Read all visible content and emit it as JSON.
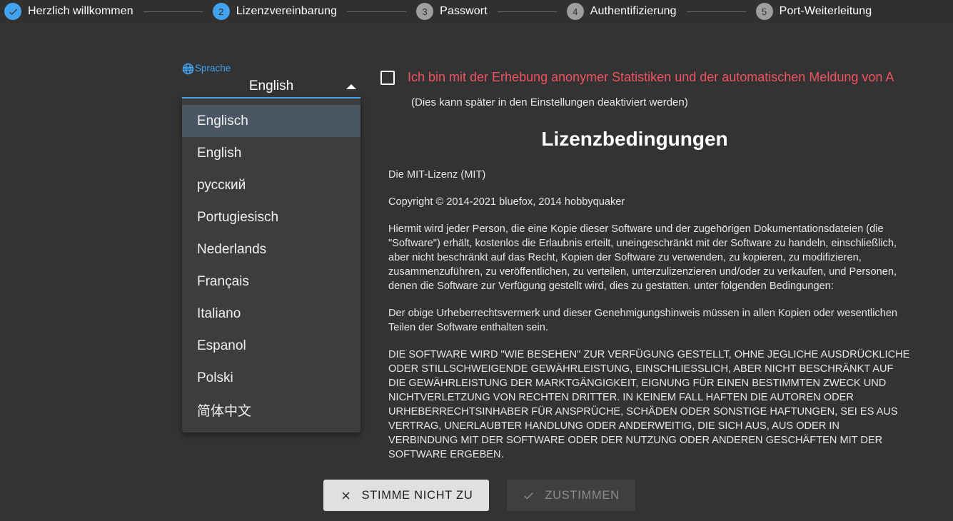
{
  "stepper": {
    "steps": [
      {
        "num": "1",
        "label": "Herzlich willkommen",
        "state": "done"
      },
      {
        "num": "2",
        "label": "Lizenzvereinbarung",
        "state": "active"
      },
      {
        "num": "3",
        "label": "Passwort",
        "state": "todo"
      },
      {
        "num": "4",
        "label": "Authentifizierung",
        "state": "todo"
      },
      {
        "num": "5",
        "label": "Port-Weiterleitung",
        "state": "todo"
      }
    ]
  },
  "language": {
    "caption": "Sprache",
    "selected": "English",
    "options": [
      "Englisch",
      "English",
      "русский",
      "Portugiesisch",
      "Nederlands",
      "Français",
      "Italiano",
      "Espanol",
      "Polski",
      "简体中文"
    ]
  },
  "statistics": {
    "consent_text": "Ich bin mit der Erhebung anonymer Statistiken und der automatischen Meldung von A",
    "hint": "(Dies kann später in den Einstellungen deaktiviert werden)"
  },
  "license": {
    "title": "Lizenzbedingungen",
    "paragraphs": [
      "Die MIT-Lizenz (MIT)",
      "Copyright © 2014-2021 bluefox, 2014 hobbyquaker",
      "Hiermit wird jeder Person, die eine Kopie dieser Software und der zugehörigen Dokumentationsdateien (die \"Software\") erhält, kostenlos die Erlaubnis erteilt, uneingeschränkt mit der Software zu handeln, einschließlich, aber nicht beschränkt auf das Recht, Kopien der Software zu verwenden, zu kopieren, zu modifizieren, zusammenzuführen, zu veröffentlichen, zu verteilen, unterzulizenzieren und/oder zu verkaufen, und Personen, denen die Software zur Verfügung gestellt wird, dies zu gestatten. unter folgenden Bedingungen:",
      "Der obige Urheberrechtsvermerk und dieser Genehmigungshinweis müssen in allen Kopien oder wesentlichen Teilen der Software enthalten sein.",
      "DIE SOFTWARE WIRD \"WIE BESEHEN\" ZUR VERFÜGUNG GESTELLT, OHNE JEGLICHE AUSDRÜCKLICHE ODER STILLSCHWEIGENDE GEWÄHRLEISTUNG, EINSCHLIESSLICH, ABER NICHT BESCHRÄNKT AUF DIE GEWÄHRLEISTUNG DER MARKTGÄNGIGKEIT, EIGNUNG FÜR EINEN BESTIMMTEN ZWECK UND NICHTVERLETZUNG VON RECHTEN DRITTER. IN KEINEM FALL HAFTEN DIE AUTOREN ODER URHEBERRECHTSINHABER FÜR ANSPRÜCHE, SCHÄDEN ODER SONSTIGE HAFTUNGEN, SEI ES AUS VERTRAG, UNERLAUBTER HANDLUNG ODER ANDERWEITIG, DIE SICH AUS, AUS ODER IN VERBINDUNG MIT DER SOFTWARE ODER DER NUTZUNG ODER ANDEREN GESCHÄFTEN MIT DER SOFTWARE ERGEBEN."
    ]
  },
  "footer": {
    "decline_label": "STIMME NICHT ZU",
    "accept_label": "ZUSTIMMEN"
  },
  "colors": {
    "accent": "#41a3f0",
    "warning": "#ef5261",
    "background": "#333333",
    "header_background": "#303030",
    "highlight": "#4a5663"
  }
}
